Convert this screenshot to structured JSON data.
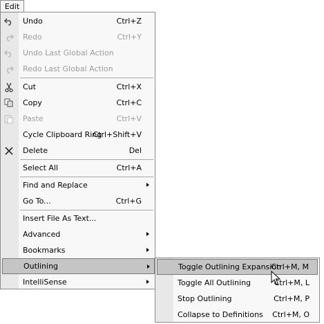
{
  "menubar": {
    "edit_label": "Edit"
  },
  "menu": {
    "items": [
      {
        "label": "Undo",
        "shortcut": "Ctrl+Z",
        "icon": "undo-icon",
        "disabled": false
      },
      {
        "label": "Redo",
        "shortcut": "Ctrl+Y",
        "icon": "redo-icon",
        "disabled": true
      },
      {
        "label": "Undo Last Global Action",
        "shortcut": "",
        "icon": "undo-global-icon",
        "disabled": true
      },
      {
        "label": "Redo Last Global Action",
        "shortcut": "",
        "icon": "redo-global-icon",
        "disabled": true
      },
      {
        "label": "Cut",
        "shortcut": "Ctrl+X",
        "icon": "scissors-icon",
        "disabled": false
      },
      {
        "label": "Copy",
        "shortcut": "Ctrl+C",
        "icon": "copy-icon",
        "disabled": false
      },
      {
        "label": "Paste",
        "shortcut": "Ctrl+V",
        "icon": "paste-icon",
        "disabled": true
      },
      {
        "label": "Cycle Clipboard Ring",
        "shortcut": "Ctrl+Shift+V",
        "icon": "",
        "disabled": false
      },
      {
        "label": "Delete",
        "shortcut": "Del",
        "icon": "delete-x-icon",
        "disabled": false
      },
      {
        "label": "Select All",
        "shortcut": "Ctrl+A",
        "icon": "",
        "disabled": false
      },
      {
        "label": "Find and Replace",
        "shortcut": "",
        "icon": "",
        "disabled": false,
        "submenu": true
      },
      {
        "label": "Go To...",
        "shortcut": "Ctrl+G",
        "icon": "",
        "disabled": false
      },
      {
        "label": "Insert File As Text...",
        "shortcut": "",
        "icon": "",
        "disabled": false
      },
      {
        "label": "Advanced",
        "shortcut": "",
        "icon": "",
        "disabled": false,
        "submenu": true
      },
      {
        "label": "Bookmarks",
        "shortcut": "",
        "icon": "",
        "disabled": false,
        "submenu": true
      },
      {
        "label": "Outlining",
        "shortcut": "",
        "icon": "",
        "disabled": false,
        "submenu": true,
        "highlighted": true
      },
      {
        "label": "IntelliSense",
        "shortcut": "",
        "icon": "",
        "disabled": false,
        "submenu": true
      }
    ]
  },
  "submenu": {
    "items": [
      {
        "label": "Toggle Outlining Expansion",
        "shortcut": "Ctrl+M, M",
        "highlighted": true
      },
      {
        "label": "Toggle All Outlining",
        "shortcut": "Ctrl+M, L"
      },
      {
        "label": "Stop Outlining",
        "shortcut": "Ctrl+M, P"
      },
      {
        "label": "Collapse to Definitions",
        "shortcut": "Ctrl+M, O"
      }
    ]
  },
  "colors": {
    "highlight": "#c5c5c5",
    "disabled_text": "#9c9c9c",
    "gutter": "#e8e8e8"
  }
}
